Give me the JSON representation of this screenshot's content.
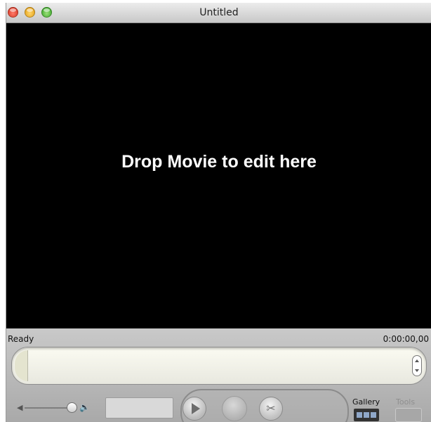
{
  "window": {
    "title": "Untitled",
    "traffic_lights": [
      "close",
      "minimize",
      "zoom"
    ]
  },
  "stage": {
    "message": "Drop Movie to edit here"
  },
  "status": {
    "text": "Ready",
    "timecode": "0:00:00,00"
  },
  "bottom_bar": {
    "gallery_label": "Gallery",
    "tools_label": "Tools"
  },
  "icons": {
    "volume_low": "speaker-low-icon",
    "volume_high": "speaker-high-icon",
    "play": "play-icon",
    "record": "record-icon",
    "cut": "scissors-icon"
  }
}
